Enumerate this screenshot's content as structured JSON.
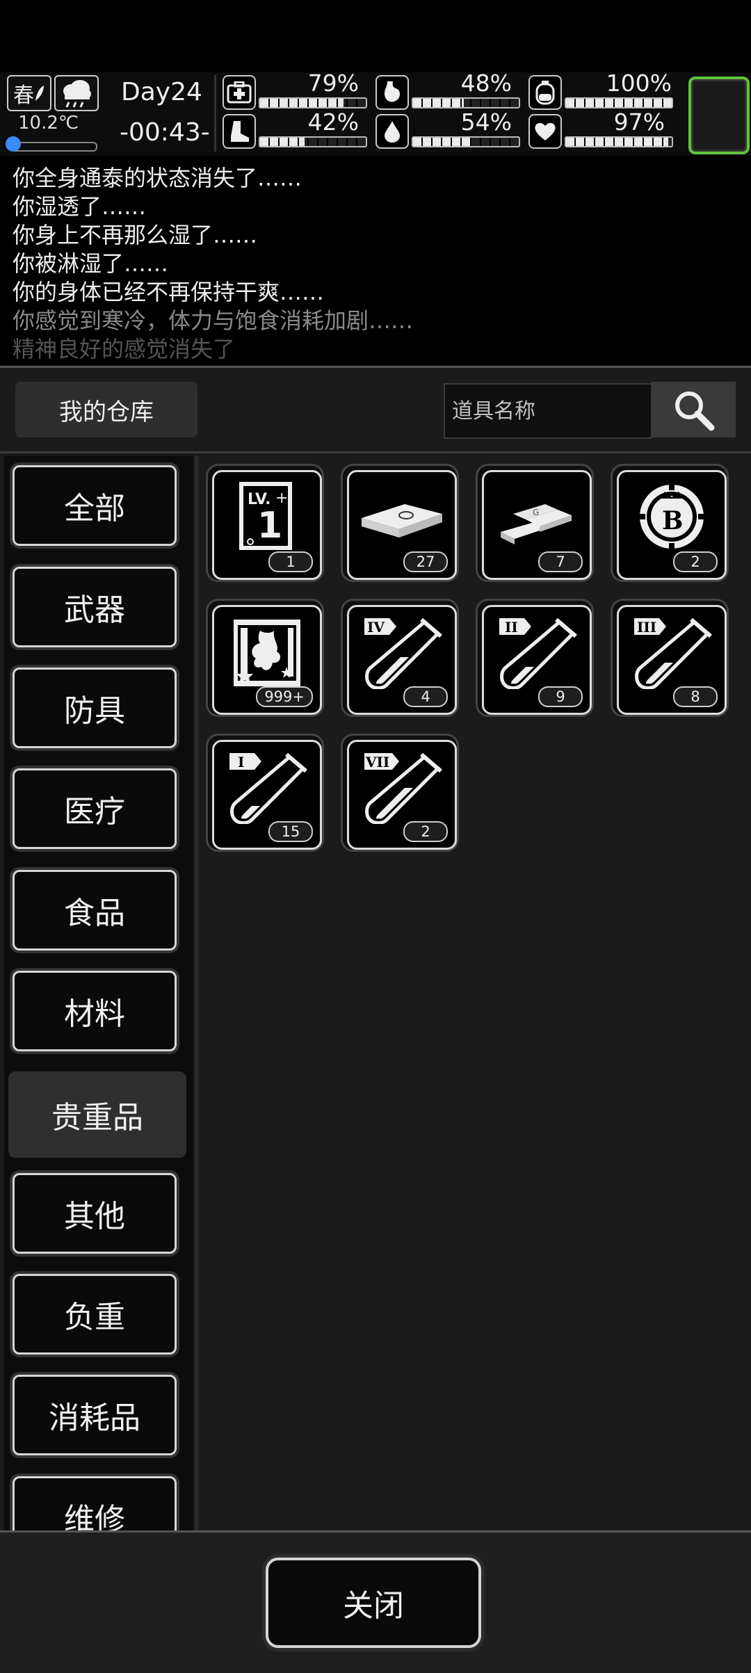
{
  "hud": {
    "season": "春",
    "temperature": "10.2℃",
    "day": "Day24",
    "clock": "-00:43-",
    "stats": [
      {
        "icon": "medkit-icon",
        "percent": "79%",
        "level": 0.79
      },
      {
        "icon": "stomach-icon",
        "percent": "48%",
        "level": 0.48
      },
      {
        "icon": "bladder-icon",
        "percent": "100%",
        "level": 1.0
      },
      {
        "icon": "boot-icon",
        "percent": "42%",
        "level": 0.42
      },
      {
        "icon": "water-drop-icon",
        "percent": "54%",
        "level": 0.54
      },
      {
        "icon": "heart-icon",
        "percent": "97%",
        "level": 0.97
      }
    ],
    "slot_color": "#5fc43a"
  },
  "log": [
    "你全身通泰的状态消失了……",
    "你湿透了……",
    "你身上不再那么湿了……",
    "你被淋湿了……",
    "你的身体已经不再保持干爽……",
    "你感觉到寒冷，体力与饱食消耗加剧……",
    "精神良好的感觉消失了"
  ],
  "warehouse": {
    "title": "我的仓库",
    "search_placeholder": "道具名称"
  },
  "categories": [
    "全部",
    "武器",
    "防具",
    "医疗",
    "食品",
    "材料",
    "贵重品",
    "其他",
    "负重",
    "消耗品",
    "维修"
  ],
  "active_category": "贵重品",
  "items": [
    {
      "icon": "level-card-icon",
      "count": "1"
    },
    {
      "icon": "cash-stack-icon",
      "count": "27"
    },
    {
      "icon": "gold-bars-icon",
      "count": "7"
    },
    {
      "icon": "casino-chip-icon",
      "count": "2"
    },
    {
      "icon": "ginseng-card-icon",
      "count": "999+"
    },
    {
      "icon": "test-tube-iv-icon",
      "count": "4",
      "roman": "IV"
    },
    {
      "icon": "test-tube-ii-icon",
      "count": "9",
      "roman": "II"
    },
    {
      "icon": "test-tube-iii-icon",
      "count": "8",
      "roman": "III"
    },
    {
      "icon": "test-tube-i-icon",
      "count": "15",
      "roman": "I"
    },
    {
      "icon": "test-tube-vii-icon",
      "count": "2",
      "roman": "VII"
    }
  ],
  "close_label": "关闭"
}
